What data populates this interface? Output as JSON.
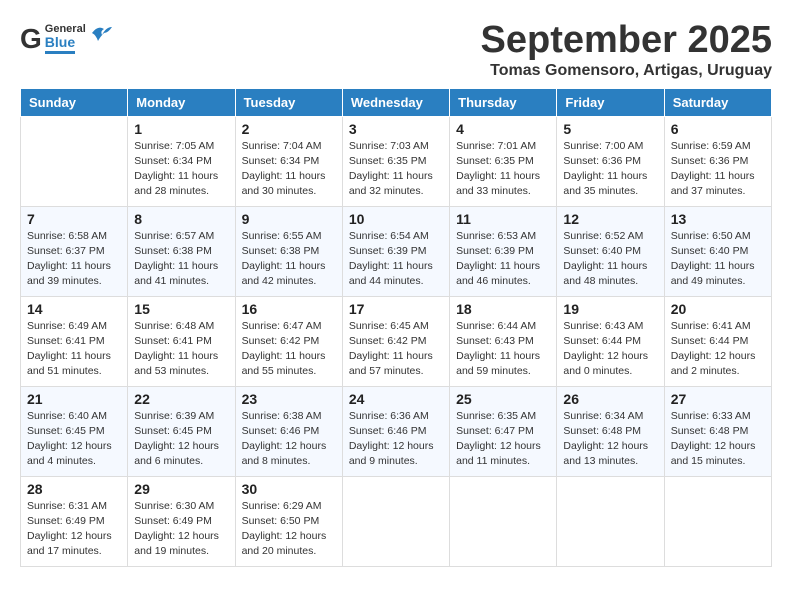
{
  "header": {
    "logo": {
      "general": "General",
      "blue": "Blue"
    },
    "month": "September 2025",
    "location": "Tomas Gomensoro, Artigas, Uruguay"
  },
  "weekdays": [
    "Sunday",
    "Monday",
    "Tuesday",
    "Wednesday",
    "Thursday",
    "Friday",
    "Saturday"
  ],
  "weeks": [
    [
      {
        "day": "",
        "info": ""
      },
      {
        "day": "1",
        "info": "Sunrise: 7:05 AM\nSunset: 6:34 PM\nDaylight: 11 hours\nand 28 minutes."
      },
      {
        "day": "2",
        "info": "Sunrise: 7:04 AM\nSunset: 6:34 PM\nDaylight: 11 hours\nand 30 minutes."
      },
      {
        "day": "3",
        "info": "Sunrise: 7:03 AM\nSunset: 6:35 PM\nDaylight: 11 hours\nand 32 minutes."
      },
      {
        "day": "4",
        "info": "Sunrise: 7:01 AM\nSunset: 6:35 PM\nDaylight: 11 hours\nand 33 minutes."
      },
      {
        "day": "5",
        "info": "Sunrise: 7:00 AM\nSunset: 6:36 PM\nDaylight: 11 hours\nand 35 minutes."
      },
      {
        "day": "6",
        "info": "Sunrise: 6:59 AM\nSunset: 6:36 PM\nDaylight: 11 hours\nand 37 minutes."
      }
    ],
    [
      {
        "day": "7",
        "info": "Sunrise: 6:58 AM\nSunset: 6:37 PM\nDaylight: 11 hours\nand 39 minutes."
      },
      {
        "day": "8",
        "info": "Sunrise: 6:57 AM\nSunset: 6:38 PM\nDaylight: 11 hours\nand 41 minutes."
      },
      {
        "day": "9",
        "info": "Sunrise: 6:55 AM\nSunset: 6:38 PM\nDaylight: 11 hours\nand 42 minutes."
      },
      {
        "day": "10",
        "info": "Sunrise: 6:54 AM\nSunset: 6:39 PM\nDaylight: 11 hours\nand 44 minutes."
      },
      {
        "day": "11",
        "info": "Sunrise: 6:53 AM\nSunset: 6:39 PM\nDaylight: 11 hours\nand 46 minutes."
      },
      {
        "day": "12",
        "info": "Sunrise: 6:52 AM\nSunset: 6:40 PM\nDaylight: 11 hours\nand 48 minutes."
      },
      {
        "day": "13",
        "info": "Sunrise: 6:50 AM\nSunset: 6:40 PM\nDaylight: 11 hours\nand 49 minutes."
      }
    ],
    [
      {
        "day": "14",
        "info": "Sunrise: 6:49 AM\nSunset: 6:41 PM\nDaylight: 11 hours\nand 51 minutes."
      },
      {
        "day": "15",
        "info": "Sunrise: 6:48 AM\nSunset: 6:41 PM\nDaylight: 11 hours\nand 53 minutes."
      },
      {
        "day": "16",
        "info": "Sunrise: 6:47 AM\nSunset: 6:42 PM\nDaylight: 11 hours\nand 55 minutes."
      },
      {
        "day": "17",
        "info": "Sunrise: 6:45 AM\nSunset: 6:42 PM\nDaylight: 11 hours\nand 57 minutes."
      },
      {
        "day": "18",
        "info": "Sunrise: 6:44 AM\nSunset: 6:43 PM\nDaylight: 11 hours\nand 59 minutes."
      },
      {
        "day": "19",
        "info": "Sunrise: 6:43 AM\nSunset: 6:44 PM\nDaylight: 12 hours\nand 0 minutes."
      },
      {
        "day": "20",
        "info": "Sunrise: 6:41 AM\nSunset: 6:44 PM\nDaylight: 12 hours\nand 2 minutes."
      }
    ],
    [
      {
        "day": "21",
        "info": "Sunrise: 6:40 AM\nSunset: 6:45 PM\nDaylight: 12 hours\nand 4 minutes."
      },
      {
        "day": "22",
        "info": "Sunrise: 6:39 AM\nSunset: 6:45 PM\nDaylight: 12 hours\nand 6 minutes."
      },
      {
        "day": "23",
        "info": "Sunrise: 6:38 AM\nSunset: 6:46 PM\nDaylight: 12 hours\nand 8 minutes."
      },
      {
        "day": "24",
        "info": "Sunrise: 6:36 AM\nSunset: 6:46 PM\nDaylight: 12 hours\nand 9 minutes."
      },
      {
        "day": "25",
        "info": "Sunrise: 6:35 AM\nSunset: 6:47 PM\nDaylight: 12 hours\nand 11 minutes."
      },
      {
        "day": "26",
        "info": "Sunrise: 6:34 AM\nSunset: 6:48 PM\nDaylight: 12 hours\nand 13 minutes."
      },
      {
        "day": "27",
        "info": "Sunrise: 6:33 AM\nSunset: 6:48 PM\nDaylight: 12 hours\nand 15 minutes."
      }
    ],
    [
      {
        "day": "28",
        "info": "Sunrise: 6:31 AM\nSunset: 6:49 PM\nDaylight: 12 hours\nand 17 minutes."
      },
      {
        "day": "29",
        "info": "Sunrise: 6:30 AM\nSunset: 6:49 PM\nDaylight: 12 hours\nand 19 minutes."
      },
      {
        "day": "30",
        "info": "Sunrise: 6:29 AM\nSunset: 6:50 PM\nDaylight: 12 hours\nand 20 minutes."
      },
      {
        "day": "",
        "info": ""
      },
      {
        "day": "",
        "info": ""
      },
      {
        "day": "",
        "info": ""
      },
      {
        "day": "",
        "info": ""
      }
    ]
  ]
}
